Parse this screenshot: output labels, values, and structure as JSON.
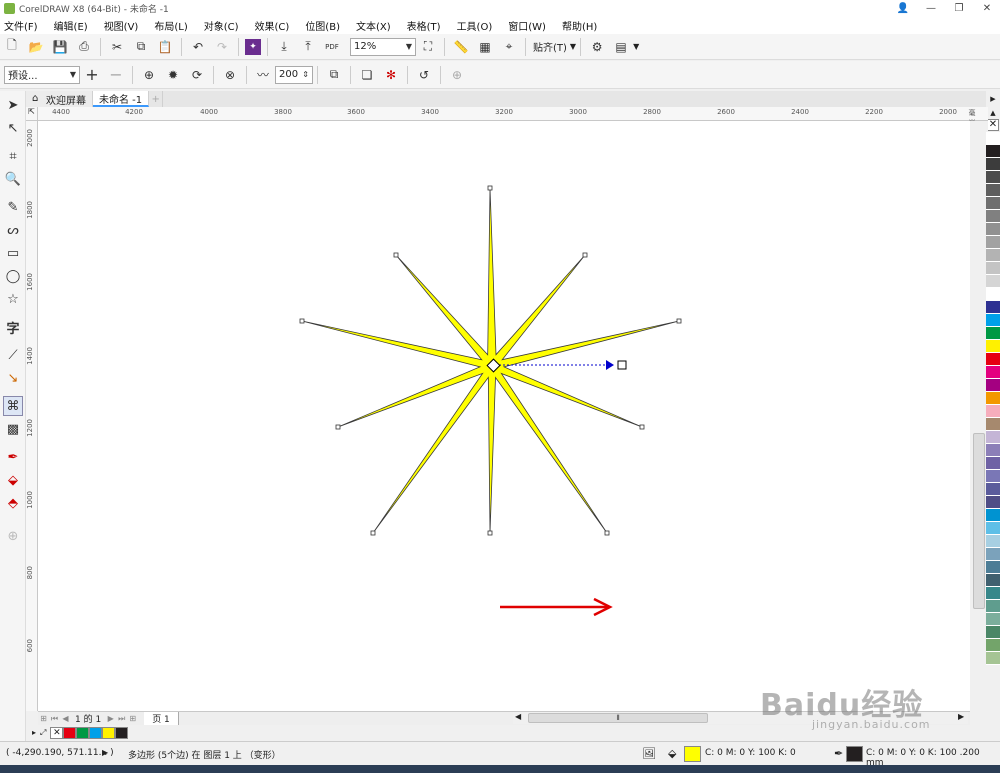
{
  "window": {
    "title": "CorelDRAW X8 (64-Bit) - 未命名 -1"
  },
  "menu": [
    "文件(F)",
    "编辑(E)",
    "视图(V)",
    "布局(L)",
    "对象(C)",
    "效果(C)",
    "位图(B)",
    "文本(X)",
    "表格(T)",
    "工具(O)",
    "窗口(W)",
    "帮助(H)"
  ],
  "toolbar": {
    "zoom_value": "12%",
    "snap_label": "贴齐(T)",
    "pdf_label": "PDF"
  },
  "propertybar": {
    "preset_value": "预设...",
    "sharpness_value": "200"
  },
  "tabs": {
    "welcome": "欢迎屏幕",
    "document": "未命名 -1"
  },
  "ruler": {
    "unit": "毫米",
    "h_labels": [
      "4400",
      "4200",
      "4000",
      "3800",
      "3600",
      "3400",
      "3200",
      "3000",
      "2800",
      "2600",
      "2400",
      "2200",
      "2000"
    ],
    "v_labels": [
      "2000",
      "1800",
      "1600",
      "1400",
      "1200",
      "1000",
      "800",
      "600"
    ]
  },
  "pagebar": {
    "page_counter": "1 的 1",
    "page_tab": "页 1"
  },
  "statusbar": {
    "coords": "( -4,290.190, 571.11... )",
    "object_info": "多边形 (5个边) 在 图层 1 上 （变形）",
    "fill_info": "C: 0 M: 0 Y: 100 K: 0",
    "outline_info": "C: 0 M: 0 Y: 0 K: 100 .200 mm"
  },
  "colors": {
    "star_fill": "#ffff00",
    "star_outline": "#3a3a3a",
    "arrow": "#e00000",
    "handle": "#0000cc"
  },
  "palette": [
    "#ffffff",
    "#231f20",
    "#3c3c3c",
    "#4d4d4d",
    "#5e5e5e",
    "#6f6f6f",
    "#808080",
    "#919191",
    "#a2a2a2",
    "#b3b3b3",
    "#c4c4c4",
    "#d5d5d5",
    "#ffffff",
    "#2e3192",
    "#00a0e9",
    "#009944",
    "#fff100",
    "#e60012",
    "#e4007f",
    "#a40081",
    "#f39800",
    "#f6adbc",
    "#a6896e",
    "#c4b5d6",
    "#8c7fb8",
    "#6f62a5",
    "#7a77b6",
    "#5b5c9c",
    "#504e86",
    "#0093d1",
    "#5ebfe7",
    "#a7cfe2",
    "#7ba2bb",
    "#4d7d96",
    "#40606f",
    "#37878a",
    "#5f9d8e",
    "#7cae9c",
    "#4b8767",
    "#73a46a",
    "#a5c494"
  ],
  "doc_palette": [
    "none",
    "#e60012",
    "#009944",
    "#00a0e9",
    "#fff100",
    "#231f20"
  ],
  "watermark": {
    "main": "Baidu经验",
    "sub": "jingyan.baidu.com"
  }
}
